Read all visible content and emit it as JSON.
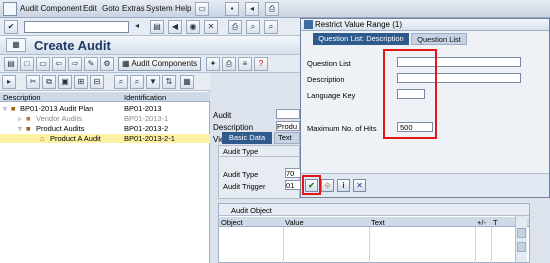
{
  "menu": {
    "items": [
      "Audit Component",
      "Edit",
      "Goto",
      "Extras",
      "System",
      "Help"
    ]
  },
  "window": {
    "title": "Create Audit"
  },
  "app_toolbar": {
    "audit_components_label": "Audit Components"
  },
  "tree": {
    "columns": [
      "Description",
      "Identification"
    ],
    "rows": [
      {
        "description": "BP01-2013 Audit Plan",
        "identification": "BP01-2013"
      },
      {
        "description": "Vendor Audits",
        "identification": "BP01-2013-1"
      },
      {
        "description": "Product Audits",
        "identification": "BP01-2013-2"
      },
      {
        "description": "Product A Audit",
        "identification": "BP01-2013-2-1"
      }
    ]
  },
  "detail": {
    "audit_label": "Audit",
    "description_label": "Description",
    "description_value": "Produ",
    "view_selection_label": "View Selection",
    "tabs": [
      "Basic Data",
      "Text"
    ],
    "audit_type_group": "Audit Type",
    "audit_type_label": "Audit Type",
    "audit_type_value": "70",
    "audit_trigger_label": "Audit Trigger",
    "audit_trigger_value": "01"
  },
  "audit_object": {
    "title": "Audit Object",
    "columns": [
      "Object",
      "Value",
      "Text",
      "+/-",
      "T"
    ]
  },
  "dialog": {
    "title": "Restrict Value Range (1)",
    "tabs": [
      "Question List: Description",
      "Question List"
    ],
    "fields": [
      {
        "label": "Question List",
        "value": ""
      },
      {
        "label": "Description",
        "value": ""
      },
      {
        "label": "Language Key",
        "value": ""
      },
      {
        "label": "Maximum No. of Hits",
        "value": "500"
      }
    ],
    "buttons": [
      "confirm",
      "multiple-selection",
      "info",
      "cancel"
    ]
  }
}
